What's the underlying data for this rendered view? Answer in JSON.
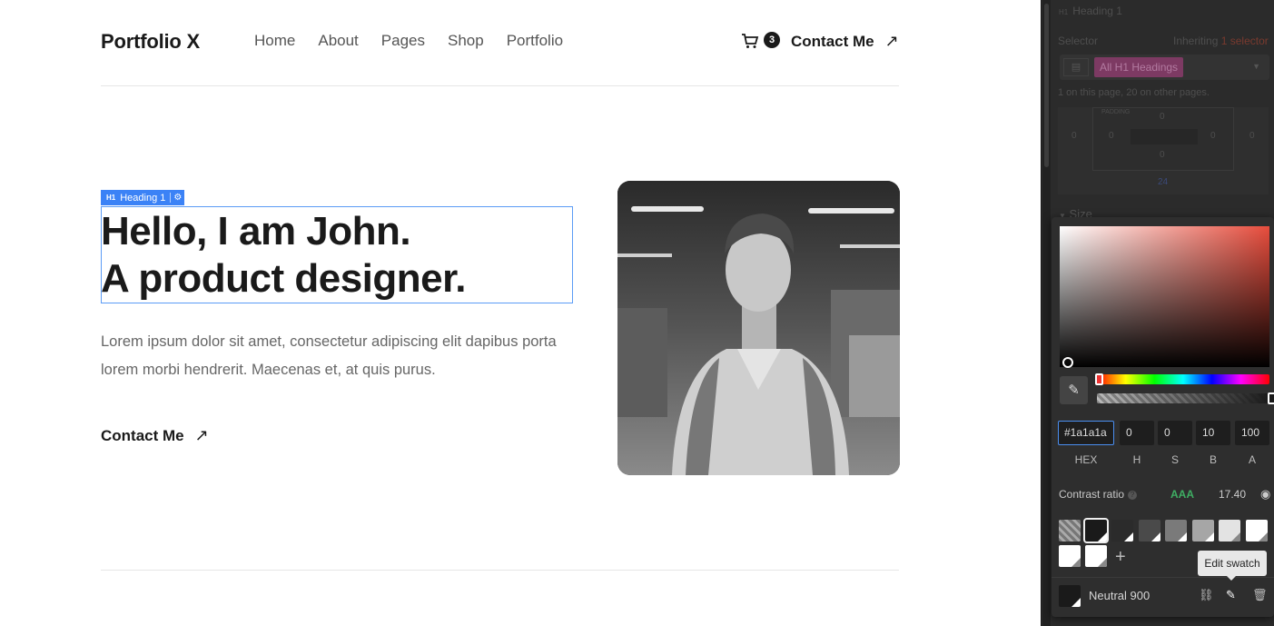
{
  "site": {
    "logo": "Portfolio X",
    "nav": [
      "Home",
      "About",
      "Pages",
      "Shop",
      "Portfolio"
    ],
    "cart_count": "3",
    "nav_contact": "Contact Me",
    "hero": {
      "title_line1": "Hello, I am John.",
      "title_line2": "A product designer.",
      "body": "Lorem ipsum dolor sit amet, consectetur adipiscing elit dapibus porta lorem morbi hendrerit. Maecenas et, at quis purus.",
      "contact": "Contact Me"
    },
    "selection_tag": {
      "prefix": "H1",
      "label": "Heading 1"
    }
  },
  "panel": {
    "header": "Heading 1",
    "selector_label": "Selector",
    "inheriting_label": "Inheriting",
    "inheriting_value": "1 selector",
    "selector_chip": "All H1 Headings",
    "page_count_note": "1 on this page, 20 on other pages.",
    "box_model": {
      "padding_label": "PADDING",
      "values": [
        "0",
        "0",
        "0",
        "0",
        "0",
        "0",
        "0"
      ],
      "bottom_value": "24"
    },
    "size_section": "Size",
    "color_picker": {
      "hex": "#1a1a1a",
      "h": "0",
      "s": "0",
      "b": "10",
      "a": "100",
      "labels": [
        "HEX",
        "H",
        "S",
        "B",
        "A"
      ],
      "contrast_label": "Contrast ratio",
      "contrast_grade": "AAA",
      "contrast_value": "17.40",
      "swatch_colors": [
        "checker",
        "#1a1a1a",
        "#2b2b2b",
        "#4a4a4a",
        "#7a7a7a",
        "#a6a6a6",
        "#e3e3e3",
        "#ffffff",
        "#ffffff",
        "#ffffff"
      ],
      "selected_swatch_name": "Neutral 900",
      "tooltip": "Edit swatch"
    },
    "colors": {
      "accent": "#4a8ef0",
      "aaa_green": "#3fae63",
      "selection_blue": "#3b82f6"
    }
  }
}
